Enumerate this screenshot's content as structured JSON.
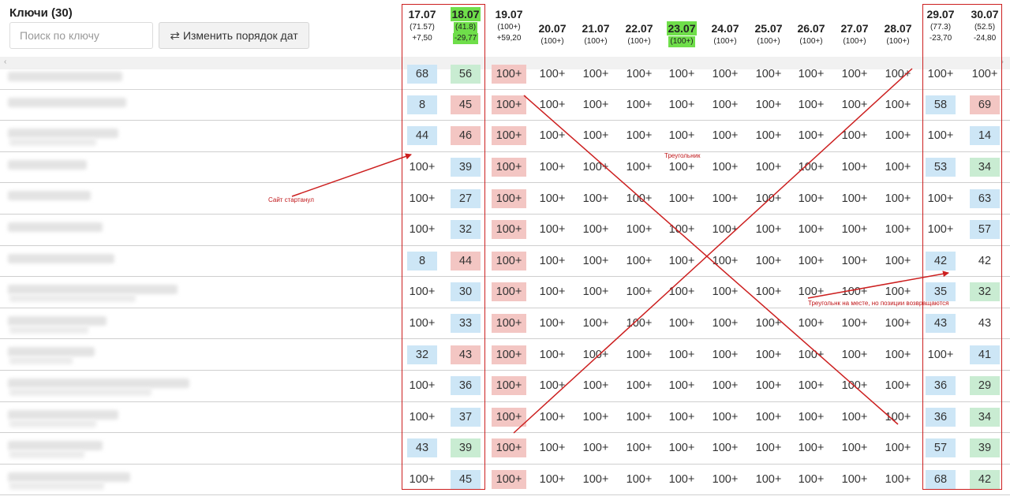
{
  "header": {
    "title": "Ключи (30)",
    "search_placeholder": "Поиск по ключу",
    "reorder_label": "Изменить порядок дат",
    "reorder_icon": "swap-arrows-icon"
  },
  "dates": [
    {
      "date": "17.07",
      "sub": "(71.57)",
      "delta": "+7,50",
      "highlight": false
    },
    {
      "date": "18.07",
      "sub": "(41.8)",
      "delta": "-29,77",
      "highlight": true
    },
    {
      "date": "19.07",
      "sub": "(100+)",
      "delta": "+59,20",
      "highlight": false
    },
    {
      "date": "20.07",
      "sub": "(100+)",
      "delta": "",
      "highlight": false
    },
    {
      "date": "21.07",
      "sub": "(100+)",
      "delta": "",
      "highlight": false
    },
    {
      "date": "22.07",
      "sub": "(100+)",
      "delta": "",
      "highlight": false
    },
    {
      "date": "23.07",
      "sub": "(100+)",
      "delta": "",
      "highlight": true
    },
    {
      "date": "24.07",
      "sub": "(100+)",
      "delta": "",
      "highlight": false
    },
    {
      "date": "25.07",
      "sub": "(100+)",
      "delta": "",
      "highlight": false
    },
    {
      "date": "26.07",
      "sub": "(100+)",
      "delta": "",
      "highlight": false
    },
    {
      "date": "27.07",
      "sub": "(100+)",
      "delta": "",
      "highlight": false
    },
    {
      "date": "28.07",
      "sub": "(100+)",
      "delta": "",
      "highlight": false
    },
    {
      "date": "29.07",
      "sub": "(77.3)",
      "delta": "-23,70",
      "highlight": false
    },
    {
      "date": "30.07",
      "sub": "(52.5)",
      "delta": "-24,80",
      "highlight": false
    }
  ],
  "rows": [
    {
      "values": [
        "68",
        "56",
        "100+",
        "100+",
        "100+",
        "100+",
        "100+",
        "100+",
        "100+",
        "100+",
        "100+",
        "100+",
        "100+",
        "100+"
      ],
      "colors": [
        "blue",
        "green",
        "red",
        "",
        "",
        "",
        "",
        "",
        "",
        "",
        "",
        "",
        "",
        ""
      ]
    },
    {
      "values": [
        "8",
        "45",
        "100+",
        "100+",
        "100+",
        "100+",
        "100+",
        "100+",
        "100+",
        "100+",
        "100+",
        "100+",
        "58",
        "69"
      ],
      "colors": [
        "blue",
        "red",
        "red",
        "",
        "",
        "",
        "",
        "",
        "",
        "",
        "",
        "",
        "blue",
        "red"
      ]
    },
    {
      "values": [
        "44",
        "46",
        "100+",
        "100+",
        "100+",
        "100+",
        "100+",
        "100+",
        "100+",
        "100+",
        "100+",
        "100+",
        "100+",
        "14"
      ],
      "colors": [
        "blue",
        "red",
        "red",
        "",
        "",
        "",
        "",
        "",
        "",
        "",
        "",
        "",
        "",
        "blue"
      ]
    },
    {
      "values": [
        "100+",
        "39",
        "100+",
        "100+",
        "100+",
        "100+",
        "100+",
        "100+",
        "100+",
        "100+",
        "100+",
        "100+",
        "53",
        "34"
      ],
      "colors": [
        "",
        "blue",
        "red",
        "",
        "",
        "",
        "",
        "",
        "",
        "",
        "",
        "",
        "blue",
        "green"
      ]
    },
    {
      "values": [
        "100+",
        "27",
        "100+",
        "100+",
        "100+",
        "100+",
        "100+",
        "100+",
        "100+",
        "100+",
        "100+",
        "100+",
        "100+",
        "63"
      ],
      "colors": [
        "",
        "blue",
        "red",
        "",
        "",
        "",
        "",
        "",
        "",
        "",
        "",
        "",
        "",
        "blue"
      ]
    },
    {
      "values": [
        "100+",
        "32",
        "100+",
        "100+",
        "100+",
        "100+",
        "100+",
        "100+",
        "100+",
        "100+",
        "100+",
        "100+",
        "100+",
        "57"
      ],
      "colors": [
        "",
        "blue",
        "red",
        "",
        "",
        "",
        "",
        "",
        "",
        "",
        "",
        "",
        "",
        "blue"
      ]
    },
    {
      "values": [
        "8",
        "44",
        "100+",
        "100+",
        "100+",
        "100+",
        "100+",
        "100+",
        "100+",
        "100+",
        "100+",
        "100+",
        "42",
        "42"
      ],
      "colors": [
        "blue",
        "red",
        "red",
        "",
        "",
        "",
        "",
        "",
        "",
        "",
        "",
        "",
        "blue",
        ""
      ]
    },
    {
      "values": [
        "100+",
        "30",
        "100+",
        "100+",
        "100+",
        "100+",
        "100+",
        "100+",
        "100+",
        "100+",
        "100+",
        "100+",
        "35",
        "32"
      ],
      "colors": [
        "",
        "blue",
        "red",
        "",
        "",
        "",
        "",
        "",
        "",
        "",
        "",
        "",
        "blue",
        "green"
      ]
    },
    {
      "values": [
        "100+",
        "33",
        "100+",
        "100+",
        "100+",
        "100+",
        "100+",
        "100+",
        "100+",
        "100+",
        "100+",
        "100+",
        "43",
        "43"
      ],
      "colors": [
        "",
        "blue",
        "red",
        "",
        "",
        "",
        "",
        "",
        "",
        "",
        "",
        "",
        "blue",
        ""
      ]
    },
    {
      "values": [
        "32",
        "43",
        "100+",
        "100+",
        "100+",
        "100+",
        "100+",
        "100+",
        "100+",
        "100+",
        "100+",
        "100+",
        "100+",
        "41"
      ],
      "colors": [
        "blue",
        "red",
        "red",
        "",
        "",
        "",
        "",
        "",
        "",
        "",
        "",
        "",
        "",
        "blue"
      ]
    },
    {
      "values": [
        "100+",
        "36",
        "100+",
        "100+",
        "100+",
        "100+",
        "100+",
        "100+",
        "100+",
        "100+",
        "100+",
        "100+",
        "36",
        "29"
      ],
      "colors": [
        "",
        "blue",
        "red",
        "",
        "",
        "",
        "",
        "",
        "",
        "",
        "",
        "",
        "blue",
        "green"
      ]
    },
    {
      "values": [
        "100+",
        "37",
        "100+",
        "100+",
        "100+",
        "100+",
        "100+",
        "100+",
        "100+",
        "100+",
        "100+",
        "100+",
        "36",
        "34"
      ],
      "colors": [
        "",
        "blue",
        "red",
        "",
        "",
        "",
        "",
        "",
        "",
        "",
        "",
        "",
        "blue",
        "green"
      ]
    },
    {
      "values": [
        "43",
        "39",
        "100+",
        "100+",
        "100+",
        "100+",
        "100+",
        "100+",
        "100+",
        "100+",
        "100+",
        "100+",
        "57",
        "39"
      ],
      "colors": [
        "blue",
        "green",
        "red",
        "",
        "",
        "",
        "",
        "",
        "",
        "",
        "",
        "",
        "blue",
        "green"
      ]
    },
    {
      "values": [
        "100+",
        "45",
        "100+",
        "100+",
        "100+",
        "100+",
        "100+",
        "100+",
        "100+",
        "100+",
        "100+",
        "100+",
        "68",
        "42"
      ],
      "colors": [
        "",
        "blue",
        "red",
        "",
        "",
        "",
        "",
        "",
        "",
        "",
        "",
        "",
        "blue",
        "green"
      ]
    }
  ],
  "annotations": {
    "started": "Сайт стартанул",
    "triangle": "Треугольник",
    "triangle_in_place": "Треугольнк на месте, но позиции возвращаются"
  },
  "colors": {
    "position_blue": "#cde6f6",
    "position_red": "#f3c6c3",
    "position_green": "#c9ecd2",
    "date_highlight": "#6fde4a",
    "annotation_red": "#cc1f1f"
  }
}
